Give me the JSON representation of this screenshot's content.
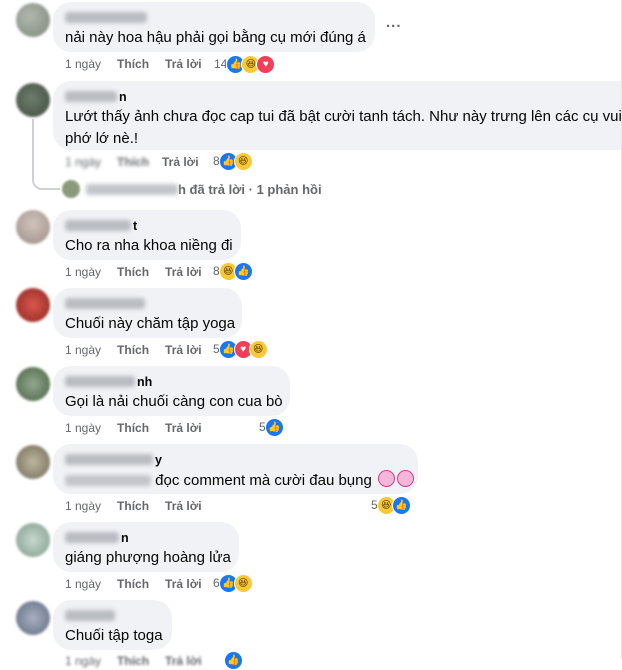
{
  "labels": {
    "like": "Thích",
    "reply": "Trả lời"
  },
  "comments": [
    {
      "name_tail": "",
      "text": "nải này hoa hậu phải gọi bằng cụ mới đúng á",
      "time": "1 ngày",
      "count": "14",
      "reactions": [
        "like",
        "haha",
        "love"
      ],
      "avatar": "#9aa39a"
    },
    {
      "name_tail": "n",
      "text": "Lướt thấy ảnh chưa đọc cap tui đã bật cười tanh tách. Như này trưng lên các cụ vui cư",
      "text2": "phớ lớ nè.!",
      "time": "1 ngày",
      "count": "8",
      "reactions": [
        "like",
        "haha"
      ],
      "avatar": "#7d8a7c"
    },
    {
      "name_tail": "t",
      "text": "Cho ra nha khoa niềng đi",
      "time": "1 ngày",
      "count": "8",
      "reactions": [
        "haha",
        "like"
      ],
      "avatar": "#b7a8a0"
    },
    {
      "name_tail": "",
      "text": "Chuối này chăm tập yoga",
      "time": "1 ngày",
      "count": "5",
      "reactions": [
        "like",
        "love",
        "haha"
      ],
      "avatar": "#c2413a"
    },
    {
      "name_tail": "nh",
      "text": "Gọi là nải chuối càng con cua bò",
      "time": "1 ngày",
      "count": "5",
      "reactions": [
        "like"
      ],
      "avatar": "#7a8d78"
    },
    {
      "name_tail": "y",
      "text": "đọc comment mà cười đau bụng",
      "time": "1 ngày",
      "count": "5",
      "reactions": [
        "haha",
        "like"
      ],
      "avatar": "#a6a08c"
    },
    {
      "name_tail": "n",
      "text": "giáng phượng hoàng lửa",
      "time": "1 ngày",
      "count": "6",
      "reactions": [
        "like",
        "haha"
      ],
      "avatar": "#9fb3a8"
    },
    {
      "name_tail": "",
      "text": "Chuối tập toga",
      "time": "1 ngày",
      "count": "",
      "reactions": [
        "like"
      ],
      "avatar": "#8e97a8"
    }
  ],
  "thread": {
    "text": "h đã trả lời · 1 phản hồi"
  },
  "more_menu": "..."
}
